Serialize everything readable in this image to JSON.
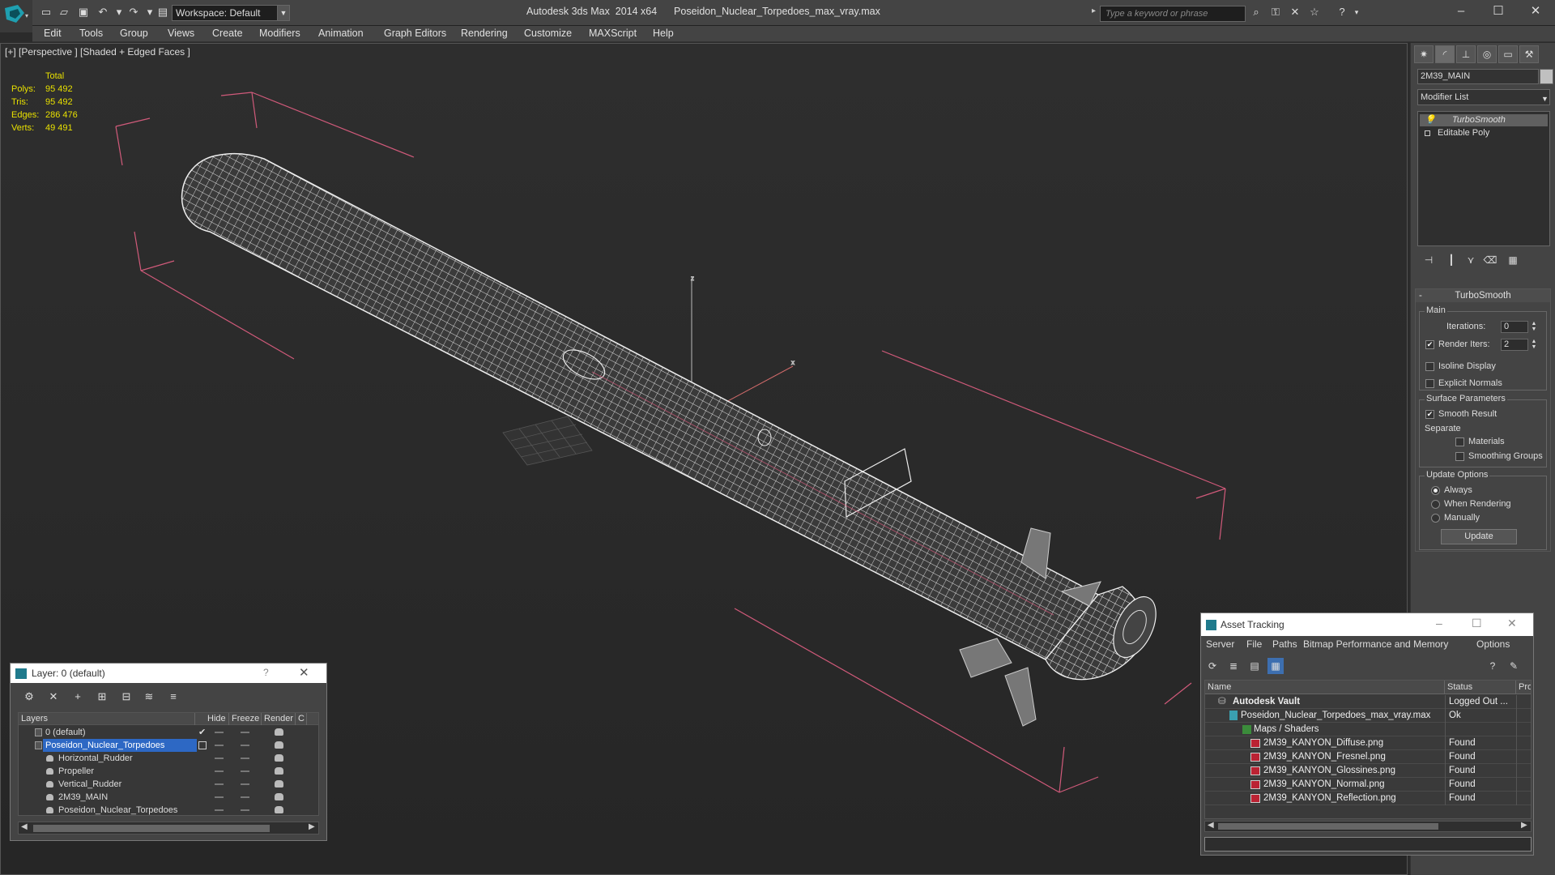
{
  "app": {
    "title": "Autodesk 3ds Max  2014 x64      Poseidon_Nuclear_Torpedoes_max_vray.max",
    "workspace": "Workspace: Default",
    "search_placeholder": "Type a keyword or phrase"
  },
  "menu": [
    "Edit",
    "Tools",
    "Group",
    "Views",
    "Create",
    "Modifiers",
    "Animation",
    "Graph Editors",
    "Rendering",
    "Customize",
    "MAXScript",
    "Help"
  ],
  "viewport": {
    "label": "[+] [Perspective ] [Shaded + Edged Faces ]",
    "stats": {
      "header": "Total",
      "rows": [
        {
          "label": "Polys:",
          "value": "95 492"
        },
        {
          "label": "Tris:",
          "value": "95 492"
        },
        {
          "label": "Edges:",
          "value": "286 476"
        },
        {
          "label": "Verts:",
          "value": "49 491"
        }
      ]
    },
    "axis_z": "z",
    "axis_x": "x"
  },
  "command_panel": {
    "object_name": "2M39_MAIN",
    "modifier_list": "Modifier List",
    "stack": [
      "TurboSmooth",
      "Editable Poly"
    ],
    "turbosmooth": {
      "title": "TurboSmooth",
      "main_group": "Main",
      "iterations_label": "Iterations:",
      "iterations_value": "0",
      "render_iters_label": "Render Iters:",
      "render_iters_value": "2",
      "isoline_label": "Isoline Display",
      "explicit_normals_label": "Explicit Normals",
      "surface_params": "Surface Parameters",
      "smooth_result": "Smooth Result",
      "separate": "Separate",
      "materials": "Materials",
      "smoothing_groups": "Smoothing Groups",
      "update_options": "Update Options",
      "always": "Always",
      "when_rendering": "When Rendering",
      "manually": "Manually",
      "update_button": "Update"
    }
  },
  "layer_window": {
    "title": "Layer: 0 (default)",
    "help": "?",
    "columns": [
      "Layers",
      "Hide",
      "Freeze",
      "Render",
      "C"
    ],
    "rows": [
      {
        "name": "0 (default)",
        "level": 1,
        "selected": false
      },
      {
        "name": "Poseidon_Nuclear_Torpedoes",
        "level": 1,
        "selected": true
      },
      {
        "name": "Horizontal_Rudder",
        "level": 2,
        "selected": false
      },
      {
        "name": "Propeller",
        "level": 2,
        "selected": false
      },
      {
        "name": "Vertical_Rudder",
        "level": 2,
        "selected": false
      },
      {
        "name": "2M39_MAIN",
        "level": 2,
        "selected": false
      },
      {
        "name": "Poseidon_Nuclear_Torpedoes",
        "level": 2,
        "selected": false
      }
    ]
  },
  "asset_window": {
    "title": "Asset Tracking",
    "menu": [
      "Server",
      "File",
      "Paths",
      "Bitmap Performance and Memory",
      "Options"
    ],
    "columns": [
      "Name",
      "Status",
      "Pro"
    ],
    "rows": [
      {
        "name": "Autodesk Vault",
        "status": "Logged Out ...",
        "level": 1
      },
      {
        "name": "Poseidon_Nuclear_Torpedoes_max_vray.max",
        "status": "Ok",
        "level": 2
      },
      {
        "name": "Maps / Shaders",
        "status": "",
        "level": 3
      },
      {
        "name": "2M39_KANYON_Diffuse.png",
        "status": "Found",
        "level": 4
      },
      {
        "name": "2M39_KANYON_Fresnel.png",
        "status": "Found",
        "level": 4
      },
      {
        "name": "2M39_KANYON_Glossines.png",
        "status": "Found",
        "level": 4
      },
      {
        "name": "2M39_KANYON_Normal.png",
        "status": "Found",
        "level": 4
      },
      {
        "name": "2M39_KANYON_Reflection.png",
        "status": "Found",
        "level": 4
      }
    ]
  }
}
